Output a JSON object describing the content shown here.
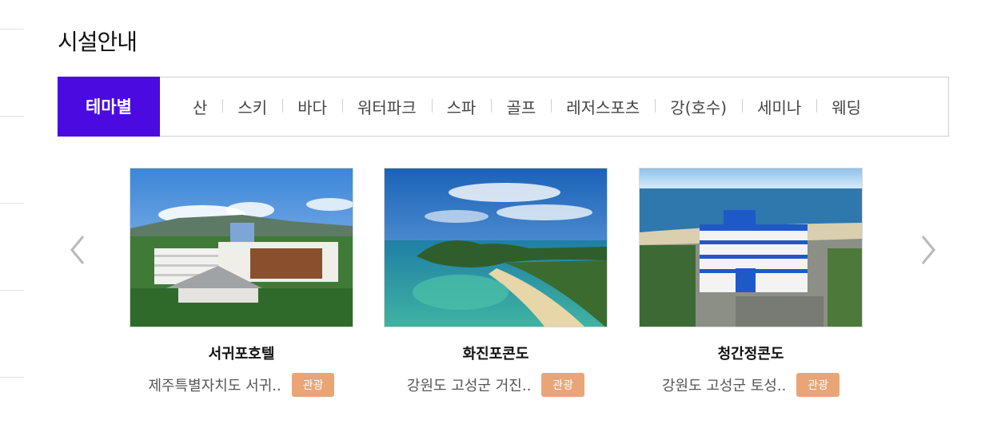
{
  "page": {
    "title": "시설안내"
  },
  "tabs": {
    "active_label": "테마별",
    "items": [
      "산",
      "스키",
      "바다",
      "워터파크",
      "스파",
      "골프",
      "레저스포츠",
      "강(호수)",
      "세미나",
      "웨딩"
    ]
  },
  "carousel": {
    "prev_icon": "chevron-left-icon",
    "next_icon": "chevron-right-icon",
    "cards": [
      {
        "name": "서귀포호텔",
        "address": "제주특별자치도 서귀..",
        "category": "관광"
      },
      {
        "name": "화진포콘도",
        "address": "강원도 고성군 거진..",
        "category": "관광"
      },
      {
        "name": "청간정콘도",
        "address": "강원도 고성군 토성..",
        "category": "관광"
      }
    ]
  },
  "colors": {
    "accent": "#4a0ae0",
    "badge": "#eaa576"
  }
}
